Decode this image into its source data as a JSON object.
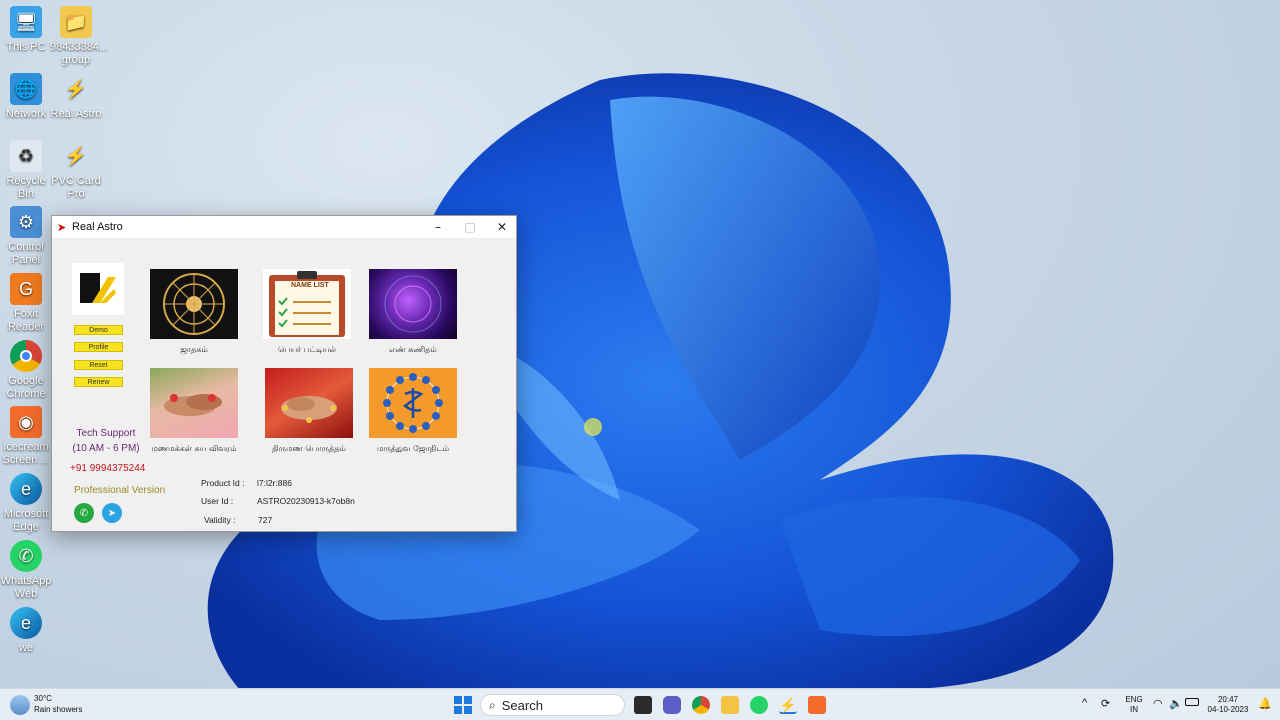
{
  "desktop": {
    "icons": [
      {
        "label": "This PC",
        "icon": "monitor-icon"
      },
      {
        "label": "98433384... group",
        "icon": "folder-icon"
      },
      {
        "label": "Network",
        "icon": "network-icon"
      },
      {
        "label": "Real Astro",
        "icon": "real-astro-icon"
      },
      {
        "label": "Recycle Bin",
        "icon": "recycle-bin-icon"
      },
      {
        "label": "PVC Card Pro",
        "icon": "pvc-card-icon"
      },
      {
        "label": "Control Panel",
        "icon": "control-panel-icon"
      },
      {
        "label": "Foxit Reader",
        "icon": "foxit-icon"
      },
      {
        "label": "Google Chrome",
        "icon": "chrome-icon"
      },
      {
        "label": "Icecream Screen ...",
        "icon": "icecream-icon"
      },
      {
        "label": "Microsoft Edge",
        "icon": "edge-icon"
      },
      {
        "label": "WhatsApp Web",
        "icon": "whatsapp-icon"
      },
      {
        "label": "we",
        "icon": "edge-icon"
      }
    ]
  },
  "window": {
    "title": "Real Astro",
    "minimize": "–",
    "maximize": "□",
    "close": "✕",
    "side_buttons": {
      "demo": "Demo",
      "profile": "Profile",
      "reset": "Reset",
      "renew": "Renew"
    },
    "tiles": [
      {
        "caption": "ஜாதகம்"
      },
      {
        "caption": "பெயர் பட்டியல்",
        "image_text": "NAME LIST"
      },
      {
        "caption": "எண் கணிதம்"
      },
      {
        "caption": "மணமக்கள் சுய விவரம்"
      },
      {
        "caption": "திருமண பொருத்தம்"
      },
      {
        "caption": "மருத்துவ ஜோதிடம்"
      }
    ],
    "support": {
      "line1": "Tech Support",
      "line2": "(10 AM - 6 PM)",
      "phone": "+91 9994375244"
    },
    "version": "Professional Version",
    "product_id_label": "Product Id :",
    "product_id_value": "l7:l2r:886",
    "user_id_label": "User Id :",
    "user_id_value": "ASTRO20230913-k7ob8n",
    "validity_label": "Validity :",
    "validity_value": "727",
    "colors": {
      "support": "#6a2a73",
      "phone": "#c0171f",
      "button": "#f6e21e"
    }
  },
  "taskbar": {
    "weather_temp": "30°C",
    "weather_desc": "Rain showers",
    "search_label": "Search",
    "lang_line1": "ENG",
    "lang_line2": "IN",
    "time": "20:47",
    "date": "04-10-2023",
    "tray_chevron": "^"
  }
}
